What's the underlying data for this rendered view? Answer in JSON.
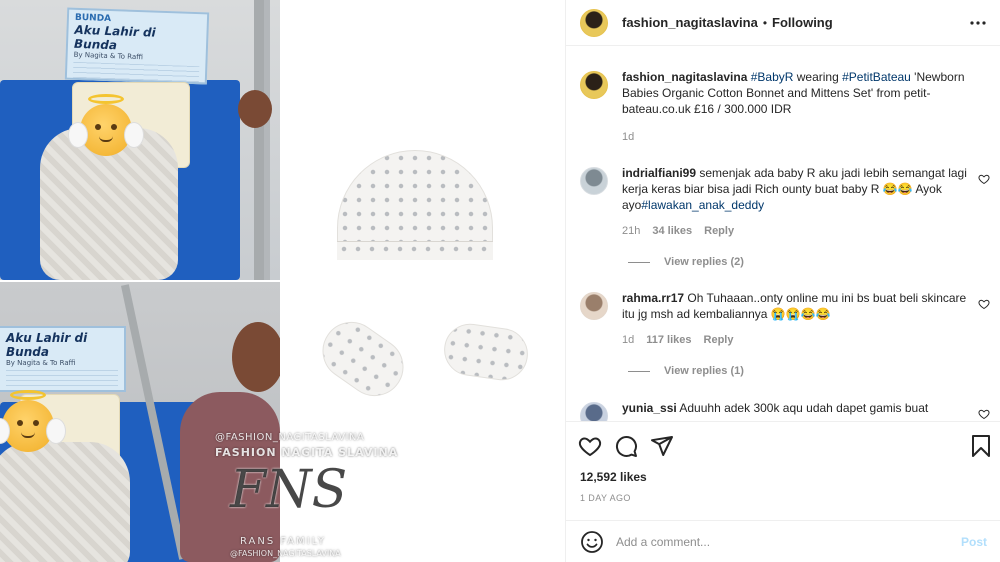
{
  "header": {
    "username": "fashion_nagitaslavina",
    "separator": "•",
    "follow_status": "Following"
  },
  "media": {
    "card_top": {
      "brand": "BUNDA",
      "title": "Aku Lahir di Bunda",
      "subtitle": "By Nagita & To Raffi"
    },
    "card_bottom": {
      "title": "Aku Lahir di Bunda",
      "subtitle": "By Nagita & To Raffi"
    },
    "watermark": {
      "handle": "@FASHION_NAGITASLAVINA",
      "name": "FASHION NAGITA SLAVINA",
      "logo": "FNS",
      "family": "RANS FAMILY",
      "handle_bottom": "@FASHION_NAGITASLAVINA"
    }
  },
  "caption": {
    "username": "fashion_nagitaslavina",
    "hashtag1": "#BabyR",
    "text1": " wearing ",
    "hashtag2": "#PetitBateau",
    "text2": " 'Newborn Babies Organic Cotton Bonnet and Mittens Set' from petit-bateau.co.uk £16 / 300.000 IDR",
    "time": "1d"
  },
  "comments": [
    {
      "username": "indrialfiani99",
      "text": "semenjak ada baby R aku jadi lebih semangat lagi kerja keras biar bisa jadi Rich ounty buat baby R 😂😂 Ayok ayo",
      "tag": "#lawakan_anak_deddy",
      "time": "21h",
      "likes": "34 likes",
      "reply": "Reply",
      "view_replies": "View replies (2)"
    },
    {
      "username": "rahma.rr17",
      "text": "Oh Tuhaaan..onty online mu ini bs buat beli skincare itu jg msh ad kembaliannya 😭😭😂😂",
      "time": "1d",
      "likes": "117 likes",
      "reply": "Reply",
      "view_replies": "View replies (1)"
    },
    {
      "username": "yunia_ssi",
      "text": "Aduuhh adek 300k aqu udah dapet gamis buat"
    }
  ],
  "footer": {
    "likes": "12,592 likes",
    "time_ago": "1 DAY AGO",
    "comment_placeholder": "Add a comment...",
    "post_label": "Post"
  },
  "colors": {
    "text": "#262626",
    "muted": "#8e8e8e",
    "link": "#00376b",
    "post_disabled": "#b2dffc",
    "border": "#efefef"
  },
  "icons": [
    "more-icon",
    "heart-icon",
    "comment-icon",
    "share-icon",
    "bookmark-icon",
    "emoji-icon"
  ]
}
